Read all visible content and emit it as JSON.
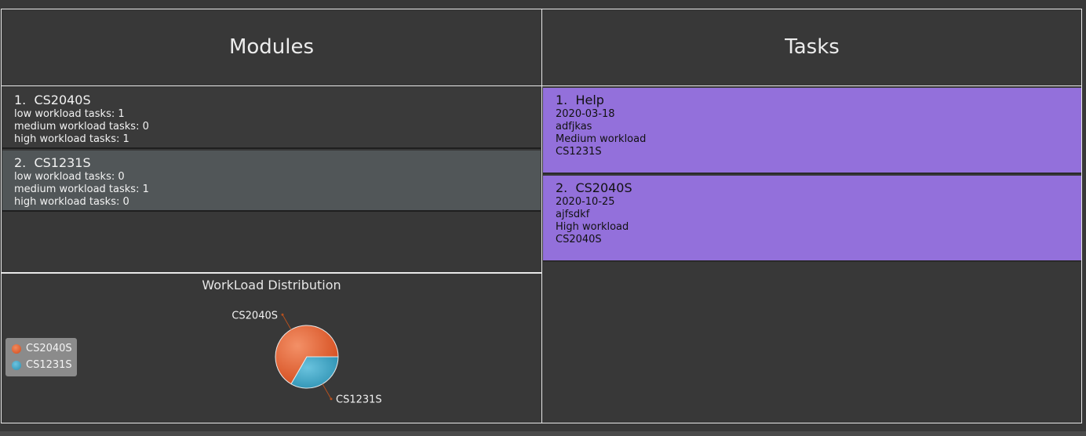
{
  "modules": {
    "header": "Modules",
    "items": [
      {
        "index": "1.",
        "code": "CS2040S",
        "low": "low workload tasks: 1",
        "medium": "medium workload tasks: 0",
        "high": "high workload tasks: 1"
      },
      {
        "index": "2.",
        "code": "CS1231S",
        "low": "low workload tasks: 0",
        "medium": "medium workload tasks: 1",
        "high": "high workload tasks: 0"
      }
    ]
  },
  "chart": {
    "title": "WorkLoad Distribution",
    "legend": [
      "CS2040S",
      "CS1231S"
    ],
    "colors": [
      "#e2582b",
      "#3aa1c2"
    ]
  },
  "chart_data": {
    "type": "pie",
    "title": "WorkLoad Distribution",
    "categories": [
      "CS2040S",
      "CS1231S"
    ],
    "values": [
      2,
      1
    ],
    "legend_position": "left"
  },
  "tasks": {
    "header": "Tasks",
    "items": [
      {
        "index": "1.",
        "name": "Help",
        "date": "2020-03-18",
        "description": "adfjkas",
        "workload": "Medium workload",
        "module": "CS1231S"
      },
      {
        "index": "2.",
        "name": "CS2040S",
        "date": "2020-10-25",
        "description": "ajfsdkf",
        "workload": "High workload",
        "module": "CS2040S"
      }
    ]
  }
}
